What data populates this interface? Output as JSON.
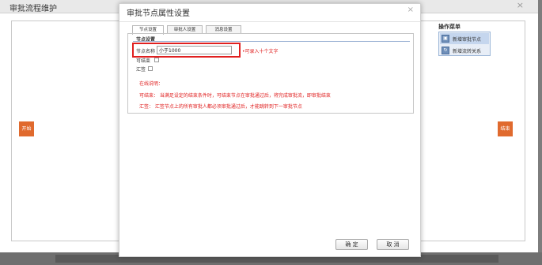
{
  "background": {
    "title": "审批流程维护",
    "close_symbol": "×",
    "start_label": "开始",
    "end_label": "结束",
    "operations": {
      "title": "操作菜单",
      "items": [
        {
          "label": "新增审批节点",
          "icon": "node-icon"
        },
        {
          "label": "新增流转关系",
          "icon": "link-icon"
        }
      ]
    }
  },
  "dialog": {
    "title": "审批节点属性设置",
    "close_symbol": "×",
    "tabs": [
      {
        "label": "节点设置",
        "active": true
      },
      {
        "label": "审批人设置",
        "active": false
      },
      {
        "label": "消息设置",
        "active": false
      }
    ],
    "group_title": "节点设置",
    "name_label": "节点名称",
    "name_value": "小于1000",
    "name_hint": "•可录入十个文字",
    "ke_label": "可结束",
    "hui_label": "汇签",
    "notes_title": "在线说明：",
    "note_ke": "可结束：    当满足设定的结束条件时，可结束节点在审批通过后，将完成审批流，即审批结束",
    "note_hui": "汇签：      汇签节点上的所有审批人都必须审批通过后，才能跳转到下一审批节点",
    "ok_label": "确 定",
    "cancel_label": "取 消"
  },
  "colors": {
    "accent_orange": "#e06a2e",
    "highlight_red": "#e02020"
  }
}
